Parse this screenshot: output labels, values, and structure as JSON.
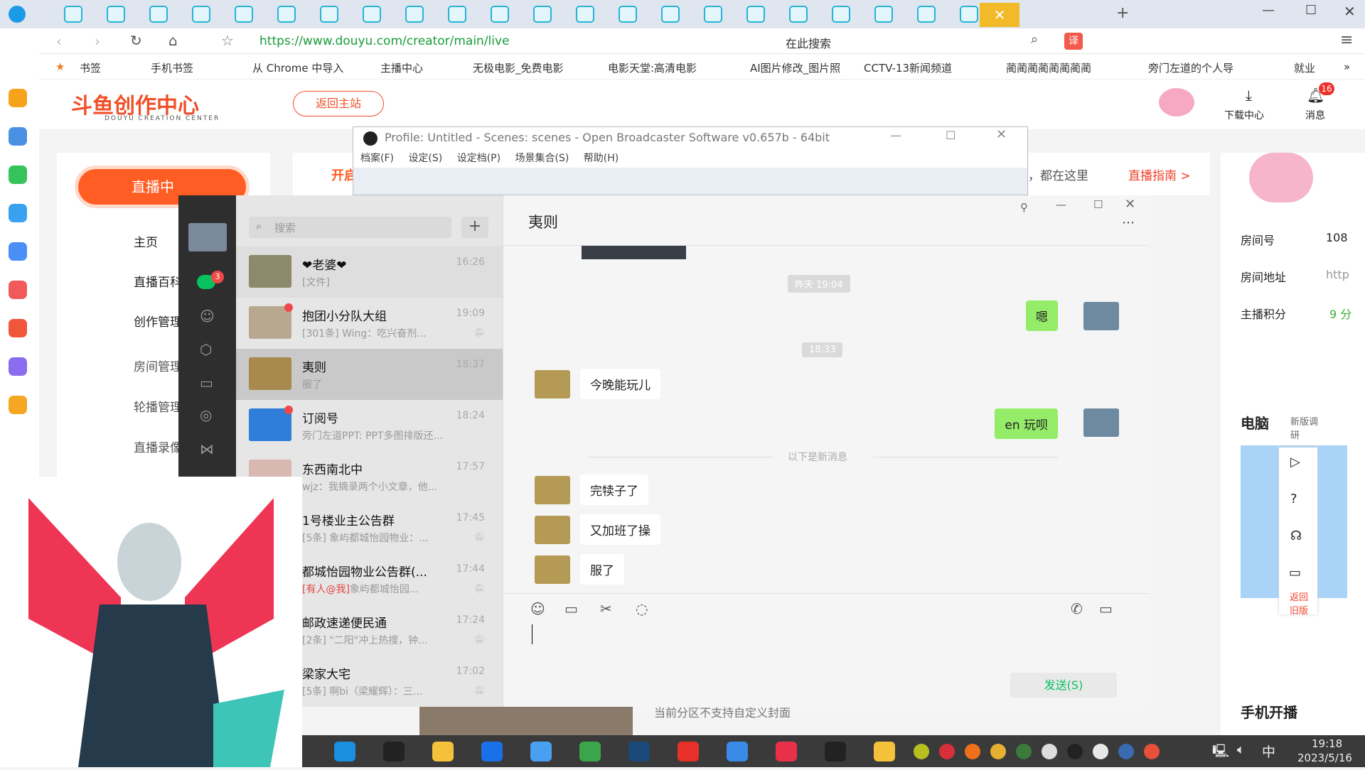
{
  "browser": {
    "url": "https://www.douyu.com/creator/main/live",
    "search_placeholder": "在此搜索",
    "bookmarks": [
      "书签",
      "手机书签",
      "从 Chrome 中导入",
      "主播中心",
      "无极电影_免费电影",
      "电影天堂:高清电影",
      "AI图片修改_图片照",
      "CCTV-13新闻频道",
      "蔺蔺蔺蔺蔺蔺蔺蔺",
      "旁门左道的个人导",
      "就业"
    ],
    "more": "»"
  },
  "douyu": {
    "logo": "斗鱼创作中心",
    "logo_sub": "DOUYU CREATION CENTER",
    "back_home": "返回主站",
    "download": "下载中心",
    "messages": "消息",
    "message_count": "16",
    "live_button": "直播中",
    "banner_left": "开启",
    "banner_right": "，都在这里",
    "guide": "直播指南 >",
    "nav": [
      "主页",
      "直播百科",
      "创作管理",
      "房间管理",
      "轮播管理",
      "直播录像"
    ],
    "info": [
      {
        "label": "房间号",
        "value": "108"
      },
      {
        "label": "房间地址",
        "value": "http"
      },
      {
        "label": "主播积分",
        "value": "9 分"
      }
    ],
    "pc": "电脑",
    "new_version": "新版调研",
    "old_version": "返回旧版",
    "mobile": "手机开播",
    "cover_note": "当前分区不支持自定义封面",
    "accent": "#ff5d23"
  },
  "obs": {
    "title": "Profile: Untitled - Scenes: scenes - Open Broadcaster Software v0.657b - 64bit",
    "menu": [
      "档案(F)",
      "设定(S)",
      "设定档(P)",
      "场景集合(S)",
      "帮助(H)"
    ]
  },
  "wechat": {
    "search_placeholder": "搜索",
    "unread": "3",
    "chats": [
      {
        "name": "❤老婆❤",
        "preview": "[文件]",
        "time": "16:26",
        "muted": false,
        "dot": false
      },
      {
        "name": "抱团小分队大组",
        "preview": "[301条] Wing：吃兴奋剂...",
        "time": "19:09",
        "muted": true,
        "dot": true
      },
      {
        "name": "夷则",
        "preview": "服了",
        "time": "18:37",
        "muted": false,
        "dot": false
      },
      {
        "name": "订阅号",
        "preview": "旁门左道PPT: PPT多图排版还...",
        "time": "18:24",
        "muted": false,
        "dot": true
      },
      {
        "name": "东西南北中",
        "preview": "wjz：我摘录两个小文章，他...",
        "time": "17:57",
        "muted": false,
        "dot": false
      },
      {
        "name": "1号楼业主公告群",
        "preview": "[5条] 象屿都城怡园物业：...",
        "time": "17:45",
        "muted": true,
        "dot": false
      },
      {
        "name": "都城怡园物业公告群(...",
        "mention": "[有人@我]",
        "preview": "象屿都城怡园...",
        "time": "17:44",
        "muted": true,
        "dot": false
      },
      {
        "name": "邮政速递便民通",
        "preview": "[2条] \"二阳\"冲上热搜，钟...",
        "time": "17:24",
        "muted": true,
        "dot": false
      },
      {
        "name": "梁家大宅",
        "preview": "[5条] 啊bi（梁耀辉）：三...",
        "time": "17:02",
        "muted": true,
        "dot": false
      }
    ],
    "chat_title": "夷则",
    "messages": {
      "ts1": "昨天 19:04",
      "m1": "嗯",
      "ts2": "18:33",
      "m2": "今晚能玩儿",
      "m3": "en 玩呗",
      "divider": "以下是新消息",
      "m4": "完犊子了",
      "m5": "又加班了操",
      "m6": "服了"
    },
    "send": "发送(S)",
    "selected_color": "#c9c9c9",
    "bubble_color": "#95ec69"
  },
  "taskbar": {
    "time": "19:18",
    "date": "2023/5/16",
    "ime": "中"
  }
}
